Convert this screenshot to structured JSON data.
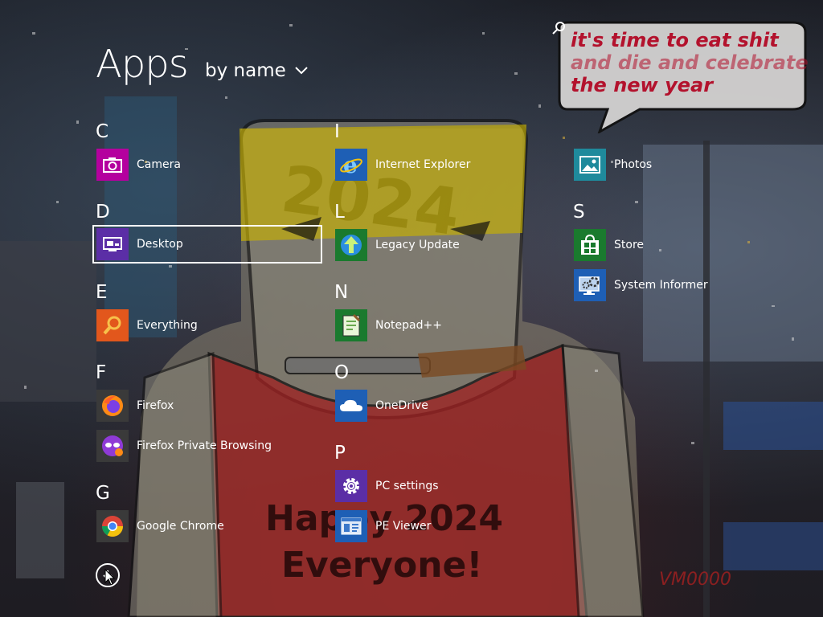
{
  "header": {
    "title": "Apps",
    "sort_label": "by name"
  },
  "search": {
    "bubble_lines": [
      "it's time to eat shit",
      "and die and celebrate",
      "the new year"
    ]
  },
  "background": {
    "poster_lines": [
      "Happy 2024",
      "Everyone!"
    ],
    "headband_text": "2024",
    "watermark": "VM0000"
  },
  "groups": [
    {
      "letter": "C",
      "apps": [
        {
          "name": "Camera",
          "icon": "camera-icon",
          "color": "#b4009e"
        }
      ]
    },
    {
      "letter": "D",
      "apps": [
        {
          "name": "Desktop",
          "icon": "desktop-icon",
          "color": "#5b2ea6",
          "selected": true
        }
      ]
    },
    {
      "letter": "E",
      "apps": [
        {
          "name": "Everything",
          "icon": "everything-search-icon",
          "color": "#e2571c"
        }
      ]
    },
    {
      "letter": "F",
      "apps": [
        {
          "name": "Firefox",
          "icon": "firefox-icon",
          "color": "#3a3a3a"
        },
        {
          "name": "Firefox Private Browsing",
          "icon": "firefox-private-icon",
          "color": "#3a3a3a"
        }
      ]
    },
    {
      "letter": "G",
      "apps": [
        {
          "name": "Google Chrome",
          "icon": "chrome-icon",
          "color": "#3a3a3a"
        }
      ]
    },
    {
      "letter": "I",
      "apps": [
        {
          "name": "Internet Explorer",
          "icon": "internet-explorer-icon",
          "color": "#1e5fb5"
        }
      ]
    },
    {
      "letter": "L",
      "apps": [
        {
          "name": "Legacy Update",
          "icon": "legacy-update-icon",
          "color": "#1a7a2e"
        }
      ]
    },
    {
      "letter": "N",
      "apps": [
        {
          "name": "Notepad++",
          "icon": "notepadpp-icon",
          "color": "#1a7a2e"
        }
      ]
    },
    {
      "letter": "O",
      "apps": [
        {
          "name": "OneDrive",
          "icon": "onedrive-icon",
          "color": "#1e5fb5"
        }
      ]
    },
    {
      "letter": "P",
      "apps": [
        {
          "name": "PC settings",
          "icon": "gear-icon",
          "color": "#5b2ea6"
        },
        {
          "name": "PE Viewer",
          "icon": "pe-viewer-icon",
          "color": "#1e5fb5"
        }
      ]
    },
    {
      "letter": "",
      "apps": [
        {
          "name": "Photos",
          "icon": "photos-icon",
          "color": "#1f8a9c"
        }
      ]
    },
    {
      "letter": "S",
      "apps": [
        {
          "name": "Store",
          "icon": "store-icon",
          "color": "#1a7a2e"
        },
        {
          "name": "System Informer",
          "icon": "system-informer-icon",
          "color": "#1e5fb5"
        }
      ]
    }
  ]
}
